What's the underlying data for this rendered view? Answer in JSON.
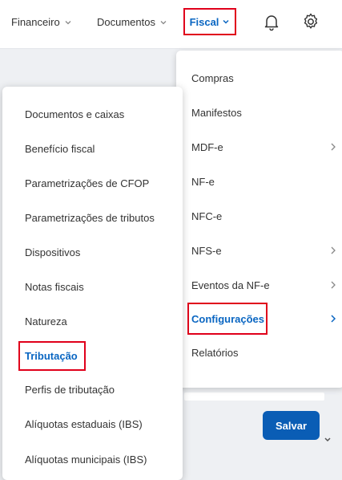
{
  "header": {
    "nav": [
      {
        "label": "Financeiro"
      },
      {
        "label": "Documentos"
      },
      {
        "label": "Fiscal"
      }
    ],
    "icons": [
      "bell-icon",
      "gear-icon"
    ]
  },
  "fiscal_menu": {
    "items": [
      {
        "label": "Compras",
        "has_submenu": false
      },
      {
        "label": "Manifestos",
        "has_submenu": false
      },
      {
        "label": "MDF-e",
        "has_submenu": true
      },
      {
        "label": "NF-e",
        "has_submenu": false
      },
      {
        "label": "NFC-e",
        "has_submenu": false
      },
      {
        "label": "NFS-e",
        "has_submenu": true
      },
      {
        "label": "Eventos da NF-e",
        "has_submenu": true
      },
      {
        "label": "Configurações",
        "has_submenu": true,
        "active": true
      },
      {
        "label": "Relatórios",
        "has_submenu": false
      }
    ]
  },
  "config_submenu": {
    "items": [
      {
        "label": "Documentos e caixas"
      },
      {
        "label": "Benefício fiscal"
      },
      {
        "label": "Parametrizações de CFOP"
      },
      {
        "label": "Parametrizações de tributos"
      },
      {
        "label": "Dispositivos"
      },
      {
        "label": "Notas fiscais"
      },
      {
        "label": "Natureza"
      },
      {
        "label": "Tributação",
        "active": true
      },
      {
        "label": "Perfis de tributação"
      },
      {
        "label": "Alíquotas estaduais (IBS)"
      },
      {
        "label": "Alíquotas municipais (IBS)"
      }
    ]
  },
  "actions": {
    "save_label": "Salvar"
  },
  "colors": {
    "accent": "#0a66c2",
    "highlight": "#e0001b",
    "button": "#0a5db5"
  }
}
